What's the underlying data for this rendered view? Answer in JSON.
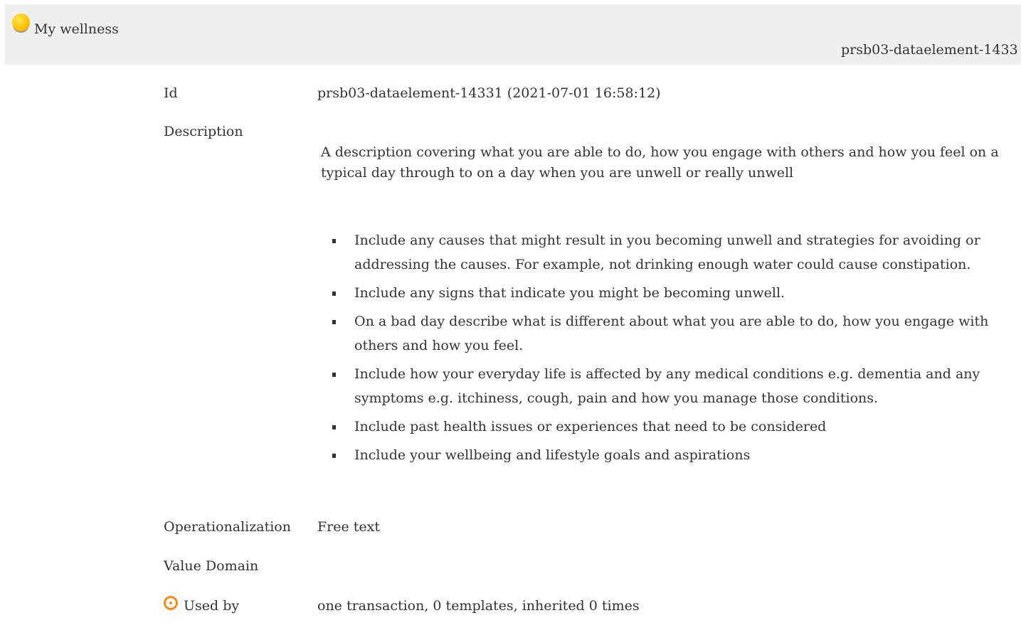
{
  "header": {
    "title": "My wellness",
    "status_icon": "yellow-circle-icon",
    "id_text": "prsb03-dataelement-1433"
  },
  "fields": {
    "id": {
      "label": "Id",
      "value": "prsb03-dataelement-14331 (2021-07-01 16:58:12)"
    },
    "description": {
      "label": "Description",
      "intro": "A description covering what you are able to do, how you engage with others and how you feel on a typical day through to on a day when you are unwell or really unwell",
      "bullets": [
        "Include any causes that might result in you becoming unwell and strategies for avoiding or addressing the causes. For example, not drinking enough water could cause constipation.",
        "Include any signs that indicate you might be becoming unwell.",
        "On a bad day describe what is different about what you are able to do, how you engage with others and how you feel.",
        "Include how your everyday life is affected by any medical conditions e.g. dementia and any symptoms e.g. itchiness, cough, pain and how you manage those conditions.",
        "Include past health issues or experiences that need to be considered",
        "Include your wellbeing and lifestyle goals and aspirations"
      ]
    },
    "operationalization": {
      "label": "Operationalization",
      "value": "Free text"
    },
    "value_domain": {
      "label": "Value Domain",
      "value": ""
    },
    "used_by": {
      "label": "Used by",
      "icon": "target-icon",
      "value": "one transaction, 0 templates, inherited 0 times"
    }
  },
  "colors": {
    "header_bg": "#f0f0f0",
    "status_yellow": "#ffc400",
    "target_orange": "#f08c1e",
    "text": "#333333"
  }
}
